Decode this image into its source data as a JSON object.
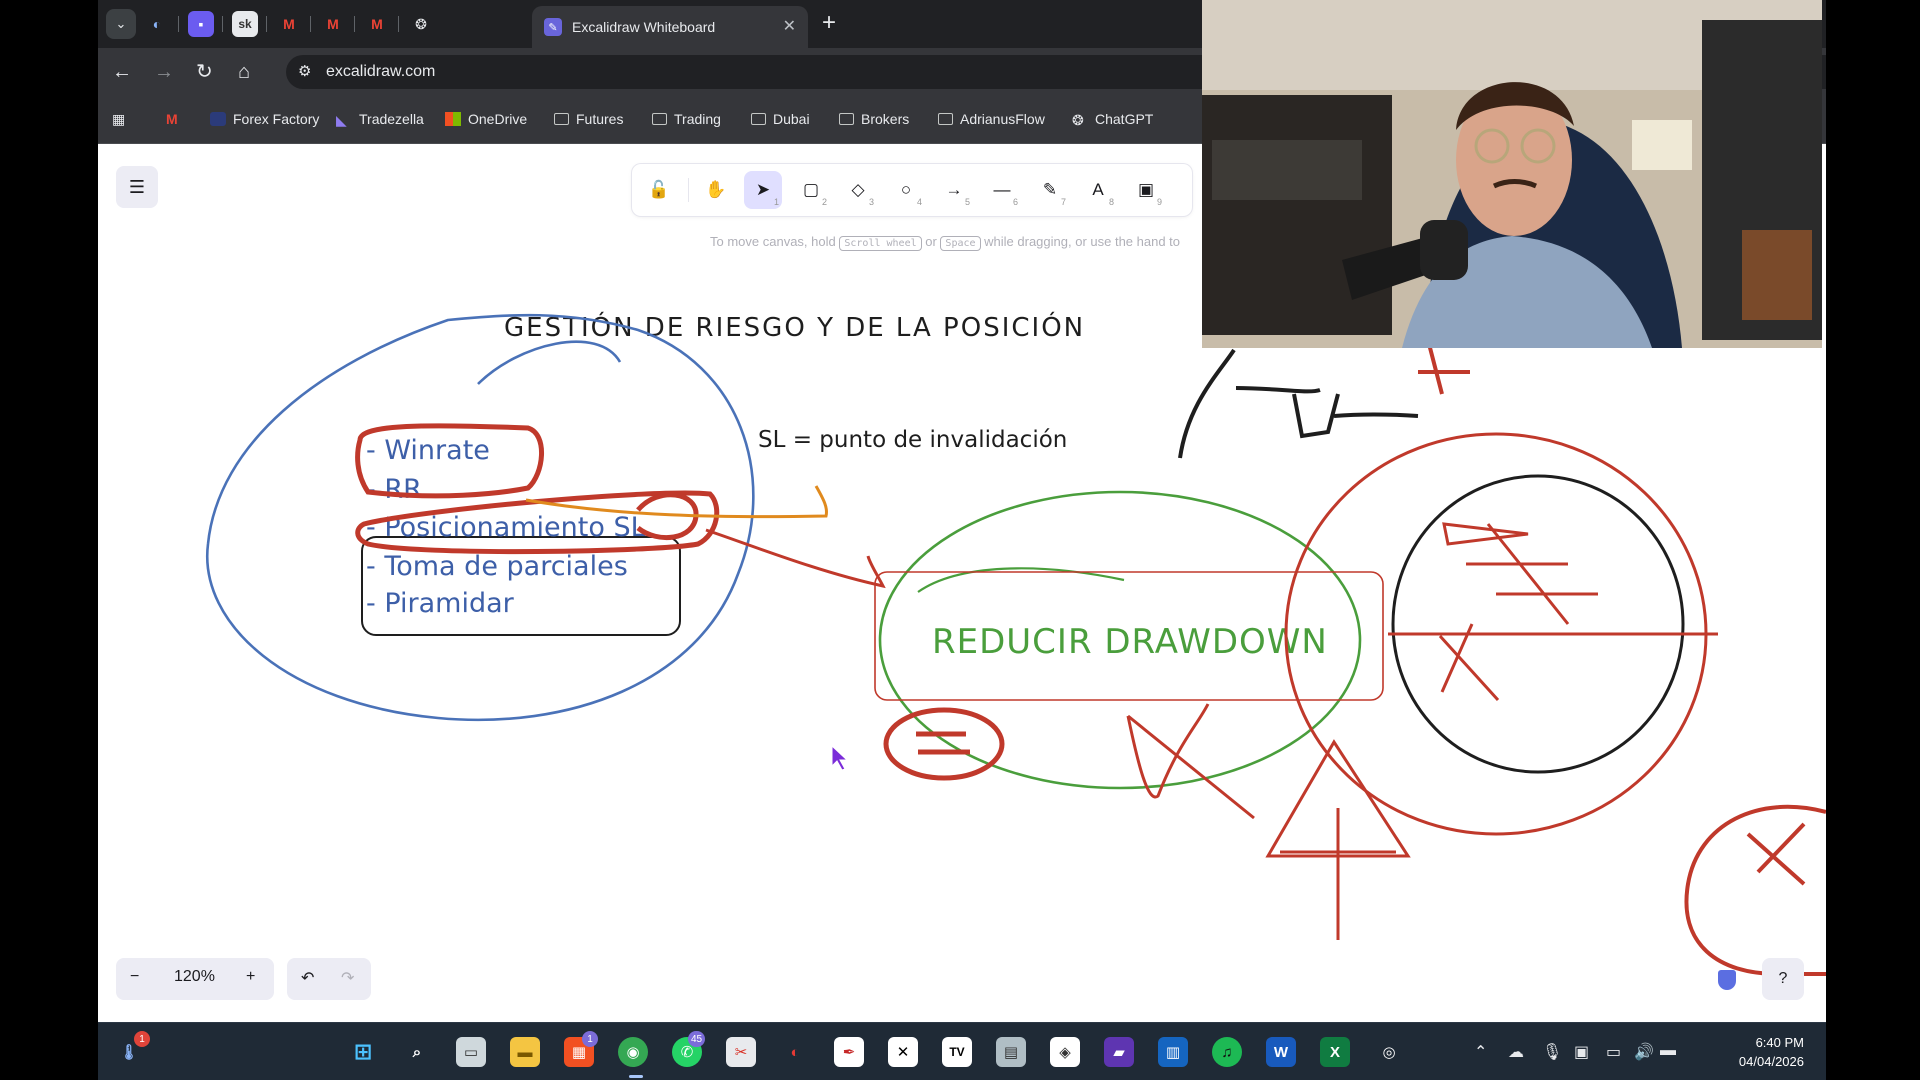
{
  "browser": {
    "active_tab_title": "Excalidraw Whiteboard",
    "url": "excalidraw.com",
    "bookmarks": [
      "Forex Factory",
      "Tradezella",
      "OneDrive",
      "Futures",
      "Trading",
      "Dubai",
      "Brokers",
      "AdrianusFlow",
      "ChatGPT"
    ]
  },
  "toolbar": {
    "tool_shortcuts": [
      "1",
      "2",
      "3",
      "4",
      "5",
      "6",
      "7",
      "8",
      "9"
    ],
    "hint_prefix": "To move canvas, hold",
    "hint_key1": "Scroll wheel",
    "hint_or": "or",
    "hint_key2": "Space",
    "hint_suffix": "while dragging, or use the hand to"
  },
  "canvas": {
    "title": "GESTIÓN DE RIESGO Y DE LA POSICIÓN",
    "list_items": [
      "- Winrate",
      "- RR",
      "- Posicionamiento SL",
      "- Toma de parciales",
      "- Piramidar"
    ],
    "sl_note": "SL = punto de invalidación",
    "box_text": "REDUCIR DRAWDOWN"
  },
  "footer": {
    "zoom_level": "120%"
  },
  "taskbar": {
    "badges": {
      "notifications": "1",
      "whatsapp": "45",
      "store": "1"
    },
    "time": "6:40 PM",
    "date": "04/04/2026"
  },
  "colors": {
    "blue": "#4a72b8",
    "red": "#c0392b",
    "green": "#4a9e3c",
    "orange": "#e08a1e",
    "accent": "#6965db"
  }
}
